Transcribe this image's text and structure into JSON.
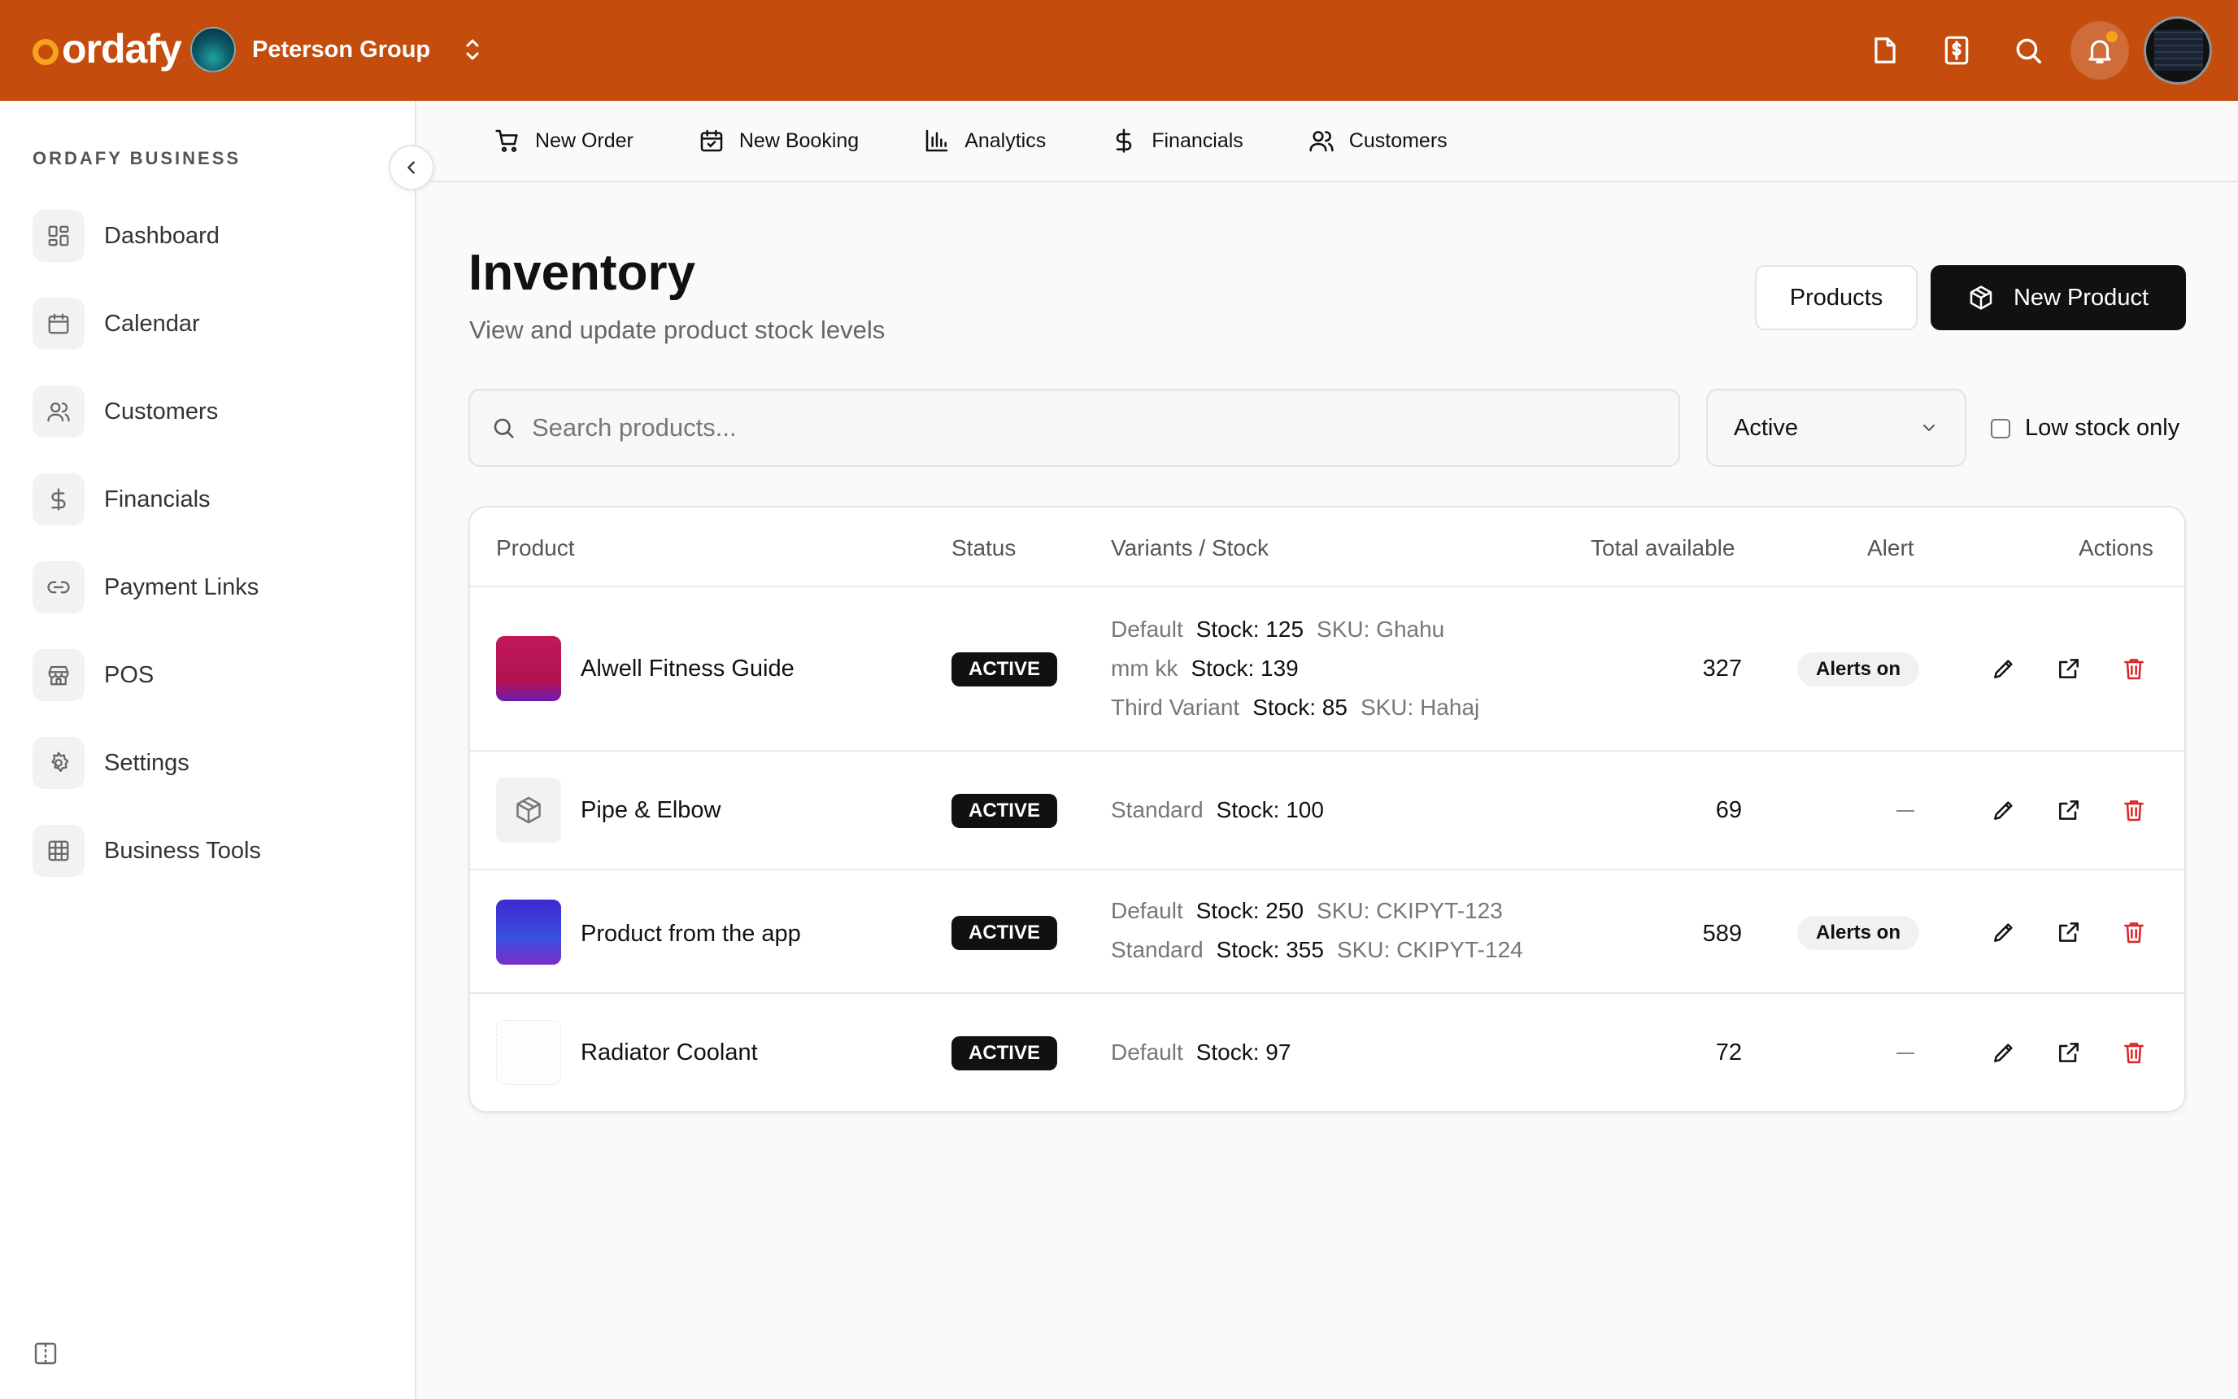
{
  "brand": {
    "logo": "ordafy",
    "org_name": "Peterson Group"
  },
  "sidebar": {
    "section_title": "ORDAFY BUSINESS",
    "items": [
      {
        "label": "Dashboard",
        "icon": "dashboard-icon"
      },
      {
        "label": "Calendar",
        "icon": "calendar-icon"
      },
      {
        "label": "Customers",
        "icon": "users-icon"
      },
      {
        "label": "Financials",
        "icon": "dollar-icon"
      },
      {
        "label": "Payment Links",
        "icon": "link-icon"
      },
      {
        "label": "POS",
        "icon": "store-icon"
      },
      {
        "label": "Settings",
        "icon": "gear-icon"
      },
      {
        "label": "Business Tools",
        "icon": "grid-icon"
      }
    ]
  },
  "quicknav": {
    "items": [
      {
        "label": "New Order",
        "icon": "cart-icon"
      },
      {
        "label": "New Booking",
        "icon": "calendar-check-icon"
      },
      {
        "label": "Analytics",
        "icon": "bar-chart-icon"
      },
      {
        "label": "Financials",
        "icon": "dollar-icon"
      },
      {
        "label": "Customers",
        "icon": "users-icon"
      }
    ]
  },
  "header": {
    "title": "Inventory",
    "subtitle": "View and update product stock levels",
    "products_button": "Products",
    "new_product_button": "New Product"
  },
  "filters": {
    "search_placeholder": "Search products...",
    "status_selected": "Active",
    "low_stock_label": "Low stock only",
    "low_stock_checked": false
  },
  "table": {
    "columns": [
      "Product",
      "Status",
      "Variants / Stock",
      "Total available",
      "Alert",
      "Actions"
    ],
    "rows": [
      {
        "name": "Alwell Fitness Guide",
        "status": "ACTIVE",
        "thumb": "pink",
        "variants": [
          {
            "name": "Default",
            "stock": "Stock: 125",
            "sku": "SKU: Ghahu"
          },
          {
            "name": "mm kk",
            "stock": "Stock: 139",
            "sku": ""
          },
          {
            "name": "Third Variant",
            "stock": "Stock: 85",
            "sku": "SKU: Hahaj"
          }
        ],
        "total": "327",
        "alert": "Alerts on"
      },
      {
        "name": "Pipe & Elbow",
        "status": "ACTIVE",
        "thumb": "box",
        "variants": [
          {
            "name": "Standard",
            "stock": "Stock: 100",
            "sku": ""
          }
        ],
        "total": "69",
        "alert": "—"
      },
      {
        "name": "Product from the app",
        "status": "ACTIVE",
        "thumb": "blue",
        "variants": [
          {
            "name": "Default",
            "stock": "Stock: 250",
            "sku": "SKU: CKIPYT-123"
          },
          {
            "name": "Standard",
            "stock": "Stock: 355",
            "sku": "SKU: CKIPYT-124"
          }
        ],
        "total": "589",
        "alert": "Alerts on"
      },
      {
        "name": "Radiator Coolant",
        "status": "ACTIVE",
        "thumb": "white",
        "variants": [
          {
            "name": "Default",
            "stock": "Stock: 97",
            "sku": ""
          }
        ],
        "total": "72",
        "alert": "—"
      }
    ]
  },
  "colors": {
    "brand": "#c44d0e",
    "accent": "#f6a21a",
    "danger": "#dc2626",
    "dark": "#111111"
  }
}
